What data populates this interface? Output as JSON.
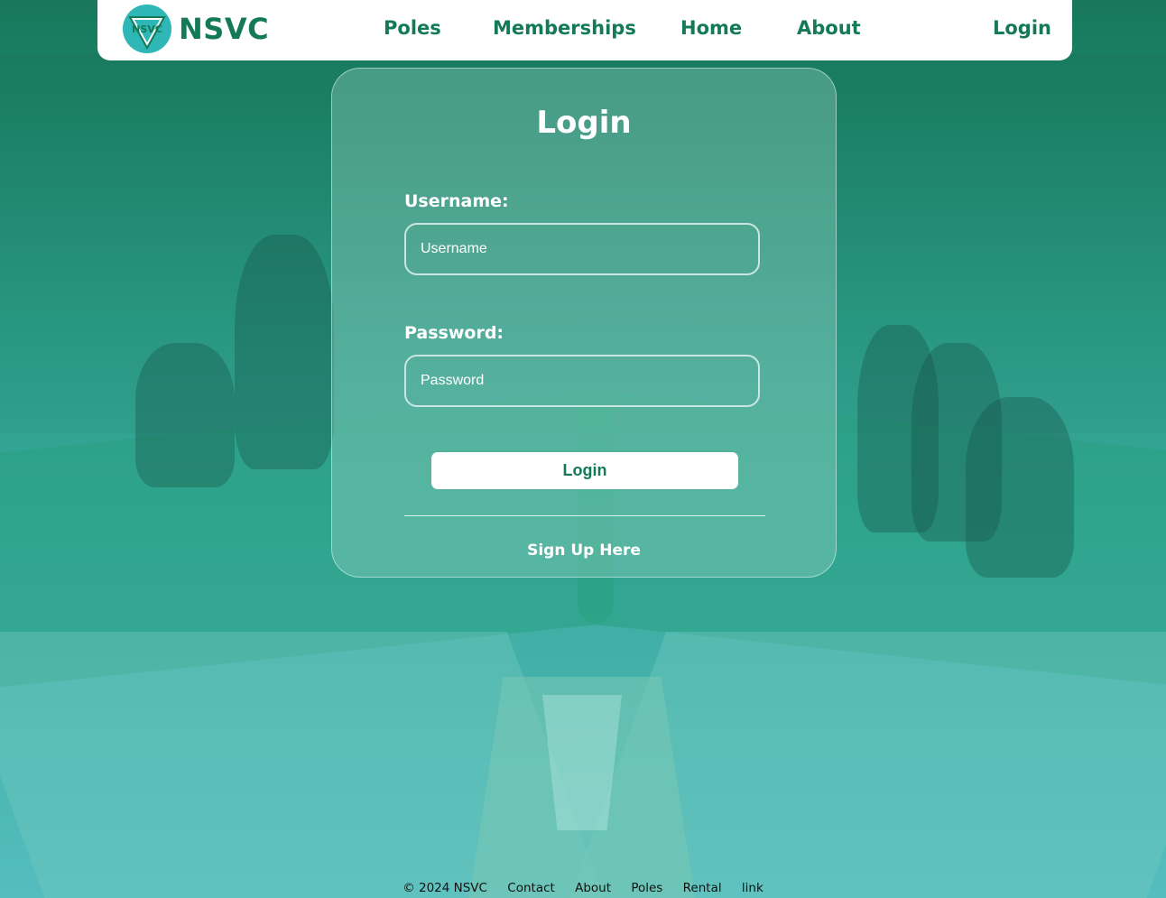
{
  "header": {
    "brand": "NSVC",
    "logo_text": "NSVC",
    "nav": [
      "Poles",
      "Memberships",
      "Home",
      "About"
    ],
    "login": "Login"
  },
  "login_card": {
    "title": "Login",
    "username": {
      "label": "Username:",
      "placeholder": "Username",
      "value": ""
    },
    "password": {
      "label": "Password:",
      "placeholder": "Password",
      "value": ""
    },
    "submit": "Login",
    "signup": "Sign Up Here"
  },
  "footer": {
    "copyright": "© 2024 NSVC",
    "links": [
      "Contact",
      "About",
      "Poles",
      "Rental",
      "link"
    ]
  },
  "colors": {
    "brand_green": "#137a55",
    "logo_teal": "#2fb6b6",
    "header_bg": "#ffffff"
  }
}
